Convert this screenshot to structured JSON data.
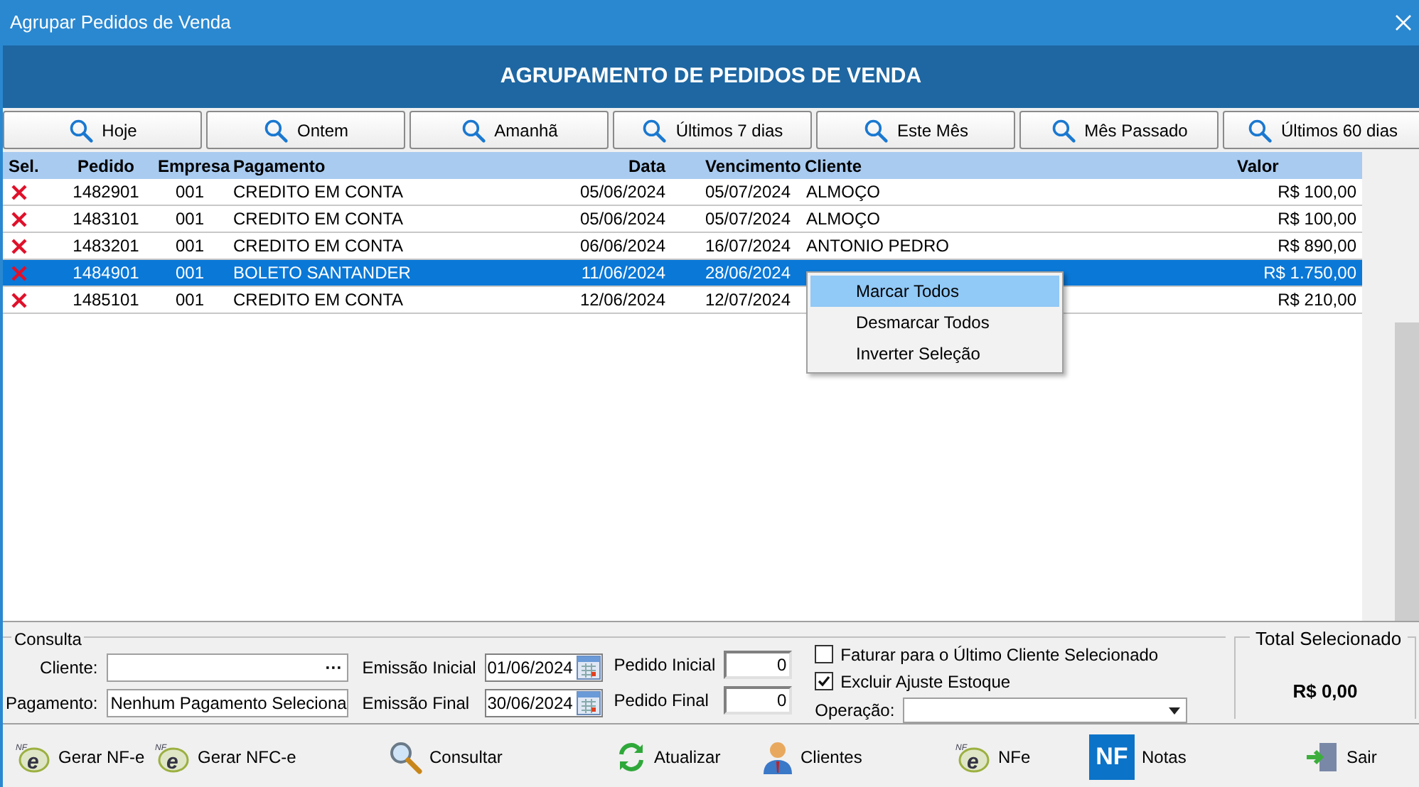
{
  "window": {
    "title": "Agrupar Pedidos de Venda"
  },
  "header": {
    "title": "AGRUPAMENTO DE PEDIDOS DE VENDA"
  },
  "period_buttons": [
    "Hoje",
    "Ontem",
    "Amanhã",
    "Últimos 7 dias",
    "Este Mês",
    "Mês Passado",
    "Últimos 60 dias"
  ],
  "table": {
    "columns": [
      "Sel.",
      "Pedido",
      "Empresa",
      "Pagamento",
      "Data",
      "Vencimento",
      "Cliente",
      "Valor"
    ],
    "rows": [
      {
        "checked": false,
        "selected": false,
        "pedido": "1482901",
        "empresa": "001",
        "pagamento": "CREDITO EM CONTA",
        "data": "05/06/2024",
        "vencimento": "05/07/2024",
        "cliente": "ALMOÇO",
        "valor": "R$ 100,00"
      },
      {
        "checked": false,
        "selected": false,
        "pedido": "1483101",
        "empresa": "001",
        "pagamento": "CREDITO EM CONTA",
        "data": "05/06/2024",
        "vencimento": "05/07/2024",
        "cliente": "ALMOÇO",
        "valor": "R$ 100,00"
      },
      {
        "checked": false,
        "selected": false,
        "pedido": "1483201",
        "empresa": "001",
        "pagamento": "CREDITO EM CONTA",
        "data": "06/06/2024",
        "vencimento": "16/07/2024",
        "cliente": "ANTONIO PEDRO",
        "valor": "R$ 890,00"
      },
      {
        "checked": false,
        "selected": true,
        "pedido": "1484901",
        "empresa": "001",
        "pagamento": "BOLETO SANTANDER",
        "data": "11/06/2024",
        "vencimento": "28/06/2024",
        "valor": "R$ 1.750,00"
      },
      {
        "checked": false,
        "selected": false,
        "pedido": "1485101",
        "empresa": "001",
        "pagamento": "CREDITO EM CONTA",
        "data": "12/06/2024",
        "vencimento": "12/07/2024",
        "valor": "R$ 210,00"
      }
    ]
  },
  "context_menu": {
    "items": [
      {
        "label": "Marcar Todos",
        "selected": true
      },
      {
        "label": "Desmarcar Todos",
        "selected": false
      },
      {
        "label": "Inverter Seleção",
        "selected": false
      }
    ]
  },
  "consulta": {
    "title": "Consulta",
    "cliente": {
      "label": "Cliente:",
      "ellipsis": "···"
    },
    "pagamento": {
      "label": "Pagamento:",
      "value": "Nenhum Pagamento Seleciona"
    },
    "emissao_inicial": {
      "label": "Emissão Inicial",
      "value": "01/06/2024"
    },
    "emissao_final": {
      "label": "Emissão Final",
      "value": "30/06/2024"
    },
    "pedido_inicial": {
      "label": "Pedido Inicial",
      "value": "0"
    },
    "pedido_final": {
      "label": "Pedido Final",
      "value": "0"
    },
    "checkboxes": [
      {
        "label": "Faturar para o Último Cliente Selecionado",
        "checked": false
      },
      {
        "label": "Excluir Ajuste Estoque",
        "checked": true
      }
    ],
    "operacao": {
      "label": "Operação:"
    }
  },
  "total": {
    "title": "Total Selecionado",
    "value": "R$ 0,00"
  },
  "toolbar": [
    {
      "label": "Gerar NF-e",
      "kind": "nfe",
      "icon_text": "e",
      "icon_mark": "NF"
    },
    {
      "label": "Gerar NFC-e",
      "kind": "nfe",
      "icon_text": "e",
      "icon_mark": "NF"
    },
    {
      "label": "Consultar",
      "kind": "search"
    },
    {
      "label": "Atualizar",
      "kind": "refresh"
    },
    {
      "label": "Clientes",
      "kind": "person"
    },
    {
      "label": "NFe",
      "kind": "nfe",
      "icon_text": "e",
      "icon_mark": "NF"
    },
    {
      "label": "Notas",
      "kind": "nf",
      "icon_text": "NF"
    },
    {
      "label": "Sair",
      "kind": "exit"
    }
  ]
}
